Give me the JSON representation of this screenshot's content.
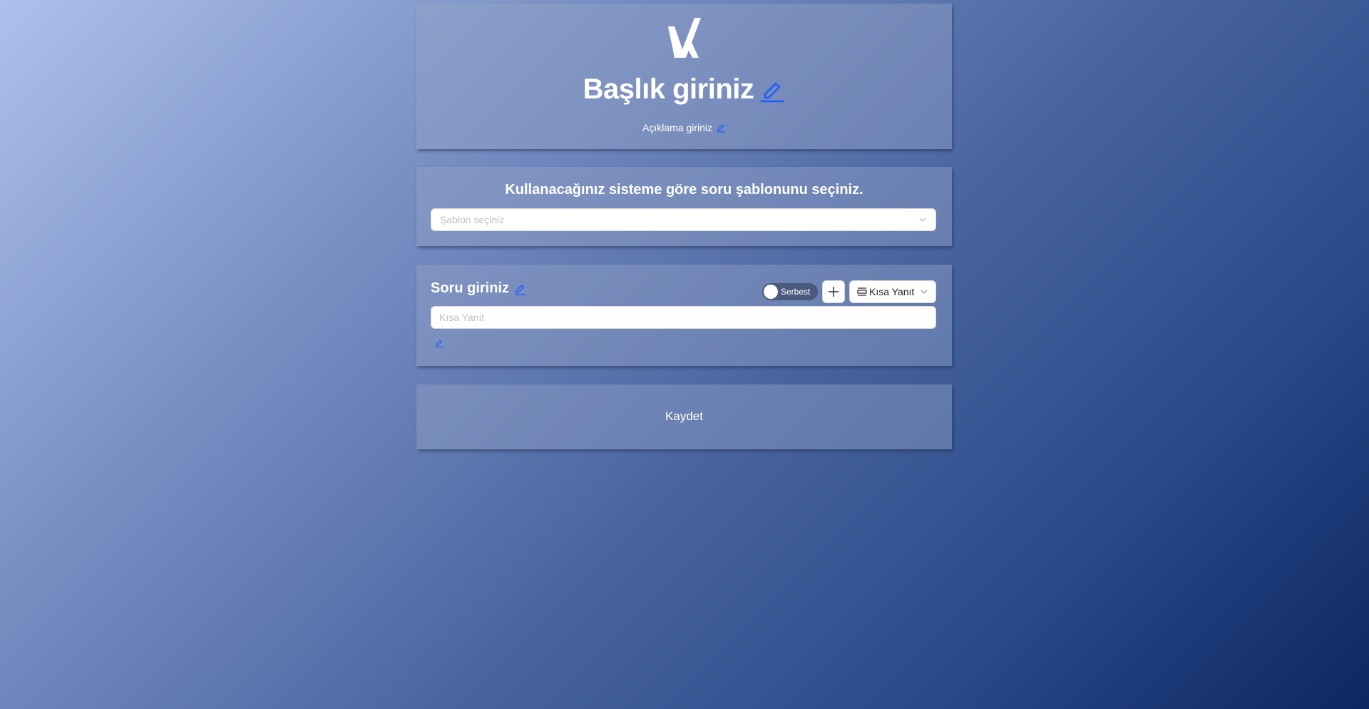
{
  "colors": {
    "accent": "#1e5eff",
    "toggle_bg": "#4a5a7d"
  },
  "header": {
    "logo_icon": "check-x-logo",
    "title": "Başlık giriniz",
    "title_edit_icon": "pencil-icon",
    "description": "Açıklama giriniz",
    "description_edit_icon": "pencil-icon"
  },
  "template": {
    "heading": "Kullanacağınız sisteme göre soru şablonunu seçiniz.",
    "select_placeholder": "Şablon seçiniz",
    "select_icon": "chevron-down-icon"
  },
  "question": {
    "title": "Soru giriniz",
    "title_edit_icon": "pencil-icon",
    "toggle_label": "Serbest",
    "toggle_on": false,
    "add_icon": "plus-icon",
    "type_icon": "short-answer-icon",
    "type_value": "Kısa Yanıt",
    "answer_placeholder": "Kısa Yanıt",
    "answer_value": "",
    "extra_edit_icon": "pencil-icon"
  },
  "save": {
    "label": "Kaydet"
  }
}
